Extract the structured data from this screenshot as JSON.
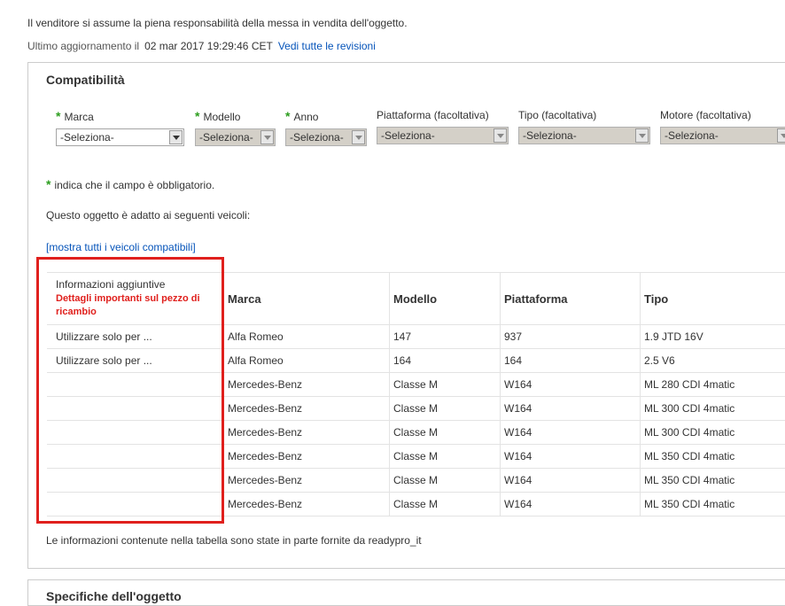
{
  "seller_note": "Il venditore si assume la piena responsabilità della messa in vendita dell'oggetto.",
  "update": {
    "label": "Ultimo aggiornamento il",
    "date": "02 mar 2017 19:29:46 CET",
    "revisions_link": "Vedi tutte le revisioni"
  },
  "compat": {
    "title": "Compatibilità",
    "required_marker": "*",
    "filters": [
      {
        "label": "Marca",
        "value": "-Seleziona-",
        "required": true
      },
      {
        "label": "Modello",
        "value": "-Seleziona-",
        "required": true
      },
      {
        "label": "Anno",
        "value": "-Seleziona-",
        "required": true
      },
      {
        "label": "Piattaforma (facoltativa)",
        "value": "-Seleziona-",
        "required": false
      },
      {
        "label": "Tipo (facoltativa)",
        "value": "-Seleziona-",
        "required": false
      },
      {
        "label": "Motore (facoltativa)",
        "value": "-Seleziona-",
        "required": false
      }
    ],
    "required_note": "indica che il campo è obbligatorio.",
    "intro": "Questo oggetto è adatto ai seguenti veicoli:",
    "show_all": "[mostra tutti i veicoli compatibili]",
    "table": {
      "info_header": "Informazioni aggiuntive",
      "info_subheader": "Dettagli importanti sul pezzo di ricambio",
      "headers": [
        "Marca",
        "Modello",
        "Piattaforma",
        "Tipo"
      ],
      "rows": [
        {
          "info": "Utilizzare solo per ...",
          "marca": "Alfa Romeo",
          "modello": "147",
          "piattaforma": "937",
          "tipo": "1.9 JTD 16V"
        },
        {
          "info": "Utilizzare solo per ...",
          "marca": "Alfa Romeo",
          "modello": "164",
          "piattaforma": "164",
          "tipo": "2.5 V6"
        },
        {
          "info": "",
          "marca": "Mercedes-Benz",
          "modello": "Classe M",
          "piattaforma": "W164",
          "tipo": "ML 280 CDI 4matic"
        },
        {
          "info": "",
          "marca": "Mercedes-Benz",
          "modello": "Classe M",
          "piattaforma": "W164",
          "tipo": "ML 300 CDI 4matic"
        },
        {
          "info": "",
          "marca": "Mercedes-Benz",
          "modello": "Classe M",
          "piattaforma": "W164",
          "tipo": "ML 300 CDI 4matic"
        },
        {
          "info": "",
          "marca": "Mercedes-Benz",
          "modello": "Classe M",
          "piattaforma": "W164",
          "tipo": "ML 350 CDI 4matic"
        },
        {
          "info": "",
          "marca": "Mercedes-Benz",
          "modello": "Classe M",
          "piattaforma": "W164",
          "tipo": "ML 350 CDI 4matic"
        },
        {
          "info": "",
          "marca": "Mercedes-Benz",
          "modello": "Classe M",
          "piattaforma": "W164",
          "tipo": "ML 350 CDI 4matic"
        }
      ]
    },
    "footnote": "Le informazioni contenute nella tabella sono state in parte fornite da readypro_it"
  },
  "specs": {
    "title": "Specifiche dell'oggetto"
  },
  "colors": {
    "link": "#0654ba",
    "required": "#2c9e1e",
    "highlight": "#e0201d"
  }
}
